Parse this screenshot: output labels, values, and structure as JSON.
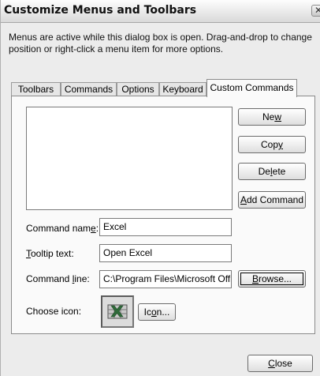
{
  "window": {
    "title": "Customize Menus and Toolbars",
    "close_glyph": "✕",
    "description_line1": "Menus are active while this dialog box is open. Drag-and-drop to change",
    "description_line2": "position or right-click a menu item for more options."
  },
  "tabs": [
    {
      "label": "Toolbars",
      "active": false
    },
    {
      "label": "Commands",
      "active": false
    },
    {
      "label": "Options",
      "active": false
    },
    {
      "label": "Keyboard",
      "active": false
    },
    {
      "label": "Custom Commands",
      "active": true
    }
  ],
  "side_buttons": {
    "new": {
      "pre": "Ne",
      "key": "w",
      "post": ""
    },
    "copy": {
      "pre": "Cop",
      "key": "y",
      "post": ""
    },
    "delete": {
      "pre": "De",
      "key": "l",
      "post": "ete"
    },
    "add_command": {
      "pre": "",
      "key": "A",
      "post": "dd Command"
    }
  },
  "form": {
    "command_name": {
      "label_pre": "Command nam",
      "label_key": "e",
      "label_post": ":",
      "value": "Excel"
    },
    "tooltip_text": {
      "label_pre": "",
      "label_key": "T",
      "label_post": "ooltip text:",
      "value": "Open Excel"
    },
    "command_line": {
      "label_pre": "Command ",
      "label_key": "l",
      "label_post": "ine:",
      "value": "C:\\Program Files\\Microsoft Offi"
    },
    "choose_icon": {
      "label": "Choose icon:"
    }
  },
  "browse_button": {
    "pre": "",
    "key": "B",
    "post": "rowse..."
  },
  "icon_button": {
    "pre": "Ic",
    "key": "o",
    "post": "n..."
  },
  "close_button": {
    "pre": "",
    "key": "C",
    "post": "lose"
  },
  "selected_icon": "excel-icon",
  "colors": {
    "excel_green": "#2f6b3a",
    "dialog_bg": "#ececec",
    "panel_bg": "#fafafa"
  }
}
